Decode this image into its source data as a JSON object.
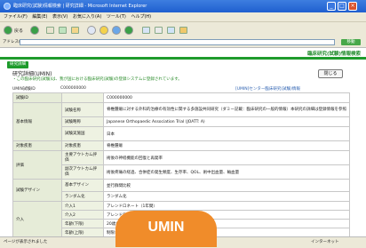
{
  "window": {
    "title": "臨床研究(試験)情報検索 | 研究詳細 - Microsoft Internet Explorer",
    "controls": [
      "_",
      "□",
      "×"
    ]
  },
  "menu": [
    "ファイル(F)",
    "編集(E)",
    "表示(V)",
    "お気に入り(A)",
    "ツール(T)",
    "ヘルプ(H)"
  ],
  "toolbar": {
    "back_label": "戻る",
    "address_label": "アドレス(D)",
    "go_label": "移動"
  },
  "site": {
    "banner_title": "臨床研究(試験)情報検索",
    "section_pill": "研究詳細"
  },
  "page": {
    "heading": "研究詳細(UMIN)",
    "subline": "・この臨床研究(試験)は、我が国における臨床研究(試験)の登録システムに登録されています。",
    "back_button": "閉じる",
    "id_label": "UMIN試験ID",
    "id_value": "C000000000",
    "right_links": "[UMIN]センター臨床研究(試験)情報"
  },
  "table": [
    {
      "cat": "試験ID",
      "sub": "",
      "val": "C000000000"
    },
    {
      "cat": "基本情報",
      "sub": "試験名称",
      "val": "脊椎腫瘍に対する外科的治療の有効性に関する多施設共同研究（ダミー記載：臨床研究の一般的情報）本研究の詳細は登録情報を参照"
    },
    {
      "cat": "",
      "sub": "試験略称",
      "val": "Japanese Orthopaedic Association Trial (JOATT: A)"
    },
    {
      "cat": "",
      "sub": "試験実施国",
      "val": "日本"
    },
    {
      "cat": "対象疾患",
      "sub": "対象疾患",
      "val": "脊椎腫瘍"
    },
    {
      "cat": "評価",
      "sub": "主要アウトカム評価",
      "val": "術後の神経機能の回復と再発率"
    },
    {
      "cat": "",
      "sub": "副次アウトカム評価",
      "val": "術後疼痛の経過、合併症の発生頻度、生存率、QOL、術中出血量、輸血量"
    },
    {
      "cat": "試験デザイン",
      "sub": "基本デザイン",
      "val": "並行群間比較"
    },
    {
      "cat": "",
      "sub": "ランダム化",
      "val": "ランダム化"
    },
    {
      "cat": "介入",
      "sub": "介入1",
      "val": "アレンドロネート（1年間）"
    },
    {
      "cat": "",
      "sub": "介入2",
      "val": "アレンドロネート（2年間）"
    },
    {
      "cat": "",
      "sub": "年齢(下限)",
      "val": "20歳以上"
    },
    {
      "cat": "",
      "sub": "年齢(上限)",
      "val": "制限なし"
    }
  ],
  "status": {
    "left": "ページが表示されました",
    "right": "インターネット"
  },
  "overlay": {
    "label": "UMIN"
  }
}
